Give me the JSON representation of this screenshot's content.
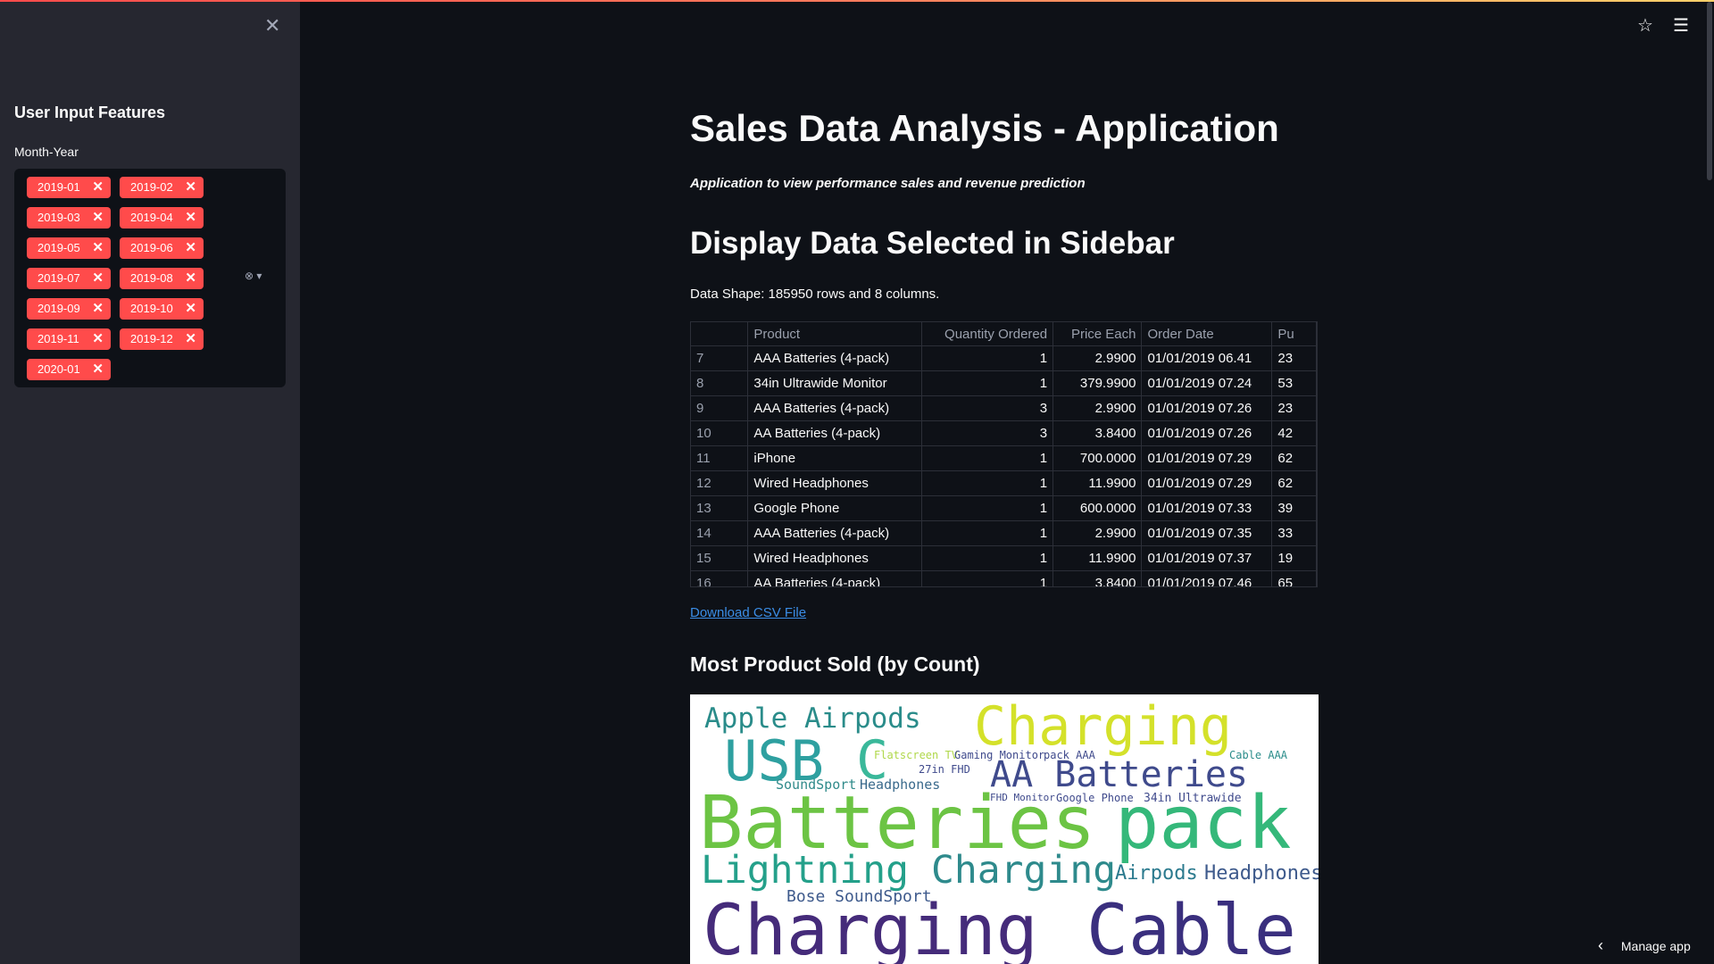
{
  "sidebar": {
    "close_icon": "✕",
    "title": "User Input Features",
    "filter_label": "Month-Year",
    "selected": [
      "2019-01",
      "2019-02",
      "2019-03",
      "2019-04",
      "2019-05",
      "2019-06",
      "2019-07",
      "2019-08",
      "2019-09",
      "2019-10",
      "2019-11",
      "2019-12",
      "2020-01"
    ],
    "chip_remove": "✕",
    "clear_icon": "⊗",
    "dropdown_icon": "▾"
  },
  "header": {
    "star_icon": "☆",
    "menu_icon": "☰"
  },
  "main": {
    "title": "Sales Data Analysis - Application",
    "subtitle": "Application to view performance sales and revenue prediction",
    "section_title": "Display Data Selected in Sidebar",
    "data_shape": "Data Shape: 185950 rows and 8 columns.",
    "table": {
      "columns": [
        "",
        "Product",
        "Quantity Ordered",
        "Price Each",
        "Order Date",
        "Pu"
      ],
      "rows": [
        [
          "7",
          "AAA Batteries (4-pack)",
          "1",
          "2.9900",
          "01/01/2019 06.41",
          "23"
        ],
        [
          "8",
          "34in Ultrawide Monitor",
          "1",
          "379.9900",
          "01/01/2019 07.24",
          "53"
        ],
        [
          "9",
          "AAA Batteries (4-pack)",
          "3",
          "2.9900",
          "01/01/2019 07.26",
          "23"
        ],
        [
          "10",
          "AA Batteries (4-pack)",
          "3",
          "3.8400",
          "01/01/2019 07.26",
          "42"
        ],
        [
          "11",
          "iPhone",
          "1",
          "700.0000",
          "01/01/2019 07.29",
          "62"
        ],
        [
          "12",
          "Wired Headphones",
          "1",
          "11.9900",
          "01/01/2019 07.29",
          "62"
        ],
        [
          "13",
          "Google Phone",
          "1",
          "600.0000",
          "01/01/2019 07.33",
          "39"
        ],
        [
          "14",
          "AAA Batteries (4-pack)",
          "1",
          "2.9900",
          "01/01/2019 07.35",
          "33"
        ],
        [
          "15",
          "Wired Headphones",
          "1",
          "11.9900",
          "01/01/2019 07.37",
          "19"
        ],
        [
          "16",
          "AA Batteries (4-pack)",
          "1",
          "3.8400",
          "01/01/2019 07.46",
          "65"
        ]
      ]
    },
    "download_link": "Download CSV File",
    "chart_title": "Most Product Sold (by Count)",
    "wordcloud_words": [
      "Apple Airpods",
      "Charging",
      "USB",
      "C",
      "AA Batteries",
      "Batteries",
      "pack",
      "Lightning",
      "Charging",
      "Airpods",
      "Headphones",
      "Bose SoundSport",
      "Charging",
      "Cable",
      "SoundSport",
      "Headphones",
      "27in FHD",
      "34in Ultrawide",
      "Flatscreen TV",
      "Gaming Monitor",
      "pack AAA",
      "Cable AAA",
      "Google Phone",
      "FHD Monitor"
    ]
  },
  "footer": {
    "chevron_icon": "‹",
    "manage_label": "Manage app"
  },
  "colors": {
    "accent": "#ff4b4b",
    "link": "#3b8de6",
    "sidebar_bg": "#262730",
    "app_bg": "#0e1117"
  }
}
